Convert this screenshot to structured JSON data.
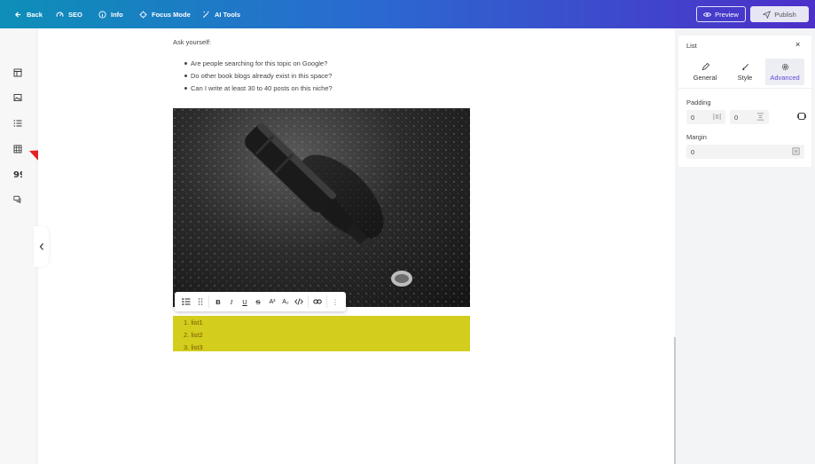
{
  "topbar": {
    "back": "Back",
    "seo": "SEO",
    "info": "Info",
    "focus_mode": "Focus Mode",
    "ai_tools": "AI Tools",
    "preview": "Preview",
    "publish": "Publish"
  },
  "left_tools": [
    "layout-icon",
    "image-icon",
    "list-icon",
    "table-icon",
    "quote-icon",
    "comment-icon"
  ],
  "content": {
    "ask_text": "Ask yourself:",
    "bullets": [
      "Are people searching for this topic on Google?",
      "Do other book blogs already exist in this space?",
      "Can I write at least 30 to 40 posts on this niche?"
    ],
    "ordered_list": [
      "1. list1",
      "2. list2",
      "3. list3"
    ],
    "list_background": "#d3cd1e"
  },
  "format_toolbar": {
    "bold": "B",
    "italic": "I",
    "underline": "U",
    "strike": "S",
    "superscript": "A²",
    "subscript": "A₂",
    "more": "⋮"
  },
  "panel": {
    "title": "List",
    "close": "×",
    "tabs": [
      {
        "label": "General",
        "icon": "pencil-icon"
      },
      {
        "label": "Style",
        "icon": "brush-icon"
      },
      {
        "label": "Advanced",
        "icon": "gear-icon",
        "active": true
      }
    ],
    "padding_label": "Padding",
    "padding_left": "0",
    "padding_right": "0",
    "margin_label": "Margin",
    "margin_value": "0"
  },
  "colors": {
    "accent": "#5b4bd6",
    "topbar_start": "#0d8fb8",
    "topbar_end": "#4d2fc9"
  }
}
